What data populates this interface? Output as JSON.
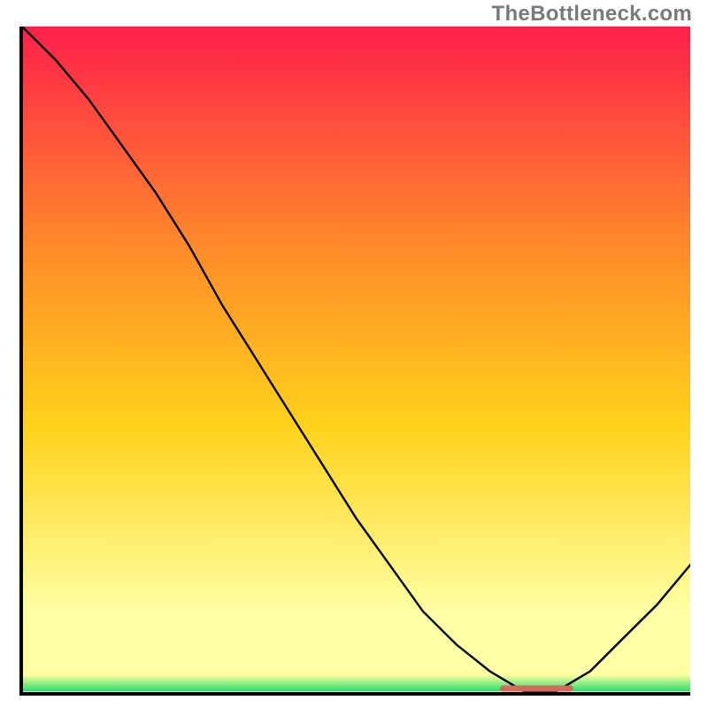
{
  "attribution": "TheBottleneck.com",
  "colors": {
    "gradient_top": "#ff1f4b",
    "gradient_mid_upper": "#ff8a2a",
    "gradient_mid": "#ffd21a",
    "gradient_low_yellow": "#ffffa3",
    "gradient_green": "#2dde69",
    "curve_stroke": "#000000",
    "marker_stroke": "#d46a5e",
    "axis": "#000000",
    "attribution_text": "#7a7a7a"
  },
  "chart_data": {
    "type": "line",
    "title": "",
    "xlabel": "",
    "ylabel": "",
    "xlim": [
      0,
      100
    ],
    "ylim": [
      0,
      100
    ],
    "x": [
      0,
      5,
      10,
      15,
      20,
      25,
      30,
      35,
      40,
      45,
      50,
      55,
      60,
      65,
      70,
      75,
      80,
      85,
      90,
      95,
      100
    ],
    "values": [
      100,
      95,
      89,
      82,
      75,
      67,
      58,
      50,
      42,
      34,
      26,
      19,
      12,
      7,
      3,
      0,
      0,
      3,
      8,
      13,
      19
    ],
    "marker": {
      "x_start": 72,
      "x_end": 82,
      "y": 0
    },
    "legend": null,
    "grid": false
  }
}
